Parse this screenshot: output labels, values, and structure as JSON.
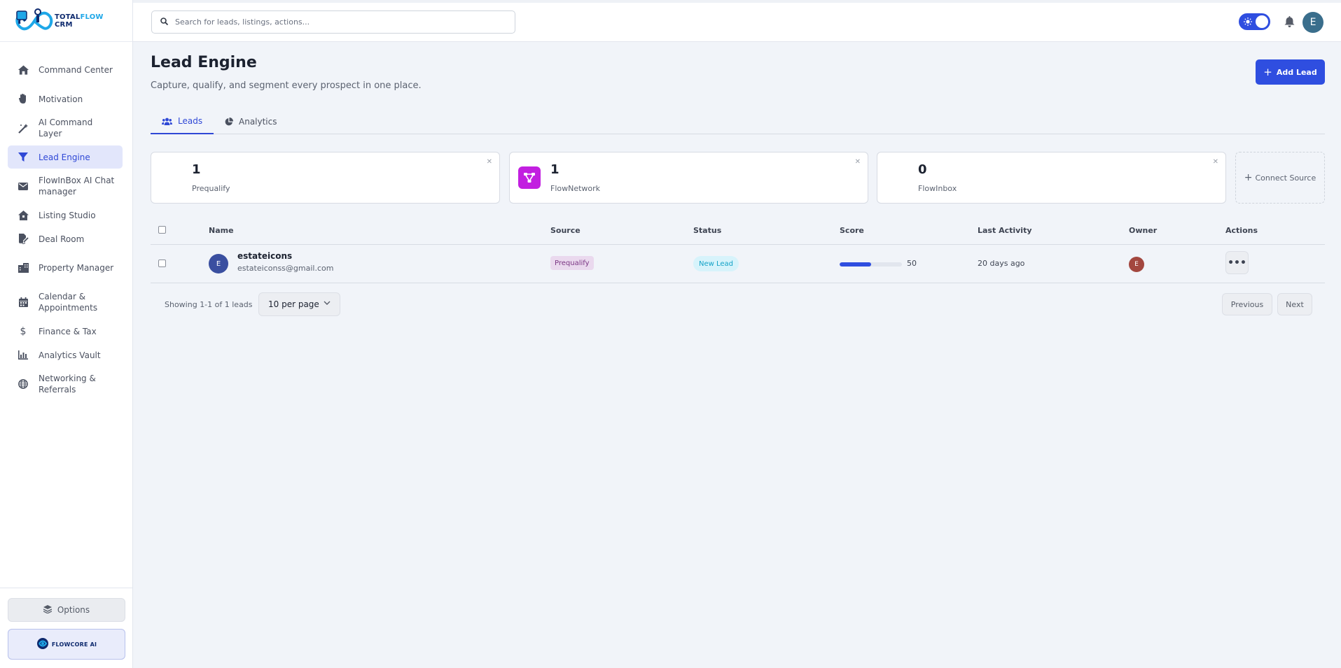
{
  "brand": {
    "line1": "TOTALFLOW",
    "line1_a": "TOTAL",
    "line1_b": "FLOW",
    "line2": "CRM"
  },
  "search": {
    "placeholder": "Search for leads, listings, actions..."
  },
  "user": {
    "initial": "E"
  },
  "sidebar": {
    "items": [
      {
        "label": "Command Center",
        "icon": "home-icon"
      },
      {
        "label": "Motivation",
        "icon": "hand-icon"
      },
      {
        "label": "AI Command Layer",
        "icon": "magic-wand-icon"
      },
      {
        "label": "Lead Engine",
        "icon": "filter-icon",
        "active": true
      },
      {
        "label": "FlowInBox AI Chat manager",
        "icon": "envelope-icon"
      },
      {
        "label": "Listing Studio",
        "icon": "house-icon"
      },
      {
        "label": "Deal Room",
        "icon": "file-signature-icon"
      },
      {
        "label": "Property Manager",
        "icon": "building-icon"
      },
      {
        "label": "Calendar & Appointments",
        "icon": "calendar-icon"
      },
      {
        "label": "Finance & Tax",
        "icon": "dollar-icon"
      },
      {
        "label": "Analytics Vault",
        "icon": "chart-icon"
      },
      {
        "label": "Networking & Referrals",
        "icon": "globe-icon"
      }
    ],
    "options_label": "Options",
    "flowcore_label": "FLOWCORE AI"
  },
  "page": {
    "title": "Lead Engine",
    "subtitle": "Capture, qualify, and segment every prospect in one place.",
    "add_button": "Add Lead"
  },
  "tabs": [
    {
      "label": "Leads",
      "active": true
    },
    {
      "label": "Analytics",
      "active": false
    }
  ],
  "sources": [
    {
      "count": "1",
      "label": "Prequalify"
    },
    {
      "count": "1",
      "label": "FlowNetwork"
    },
    {
      "count": "0",
      "label": "FlowInbox"
    }
  ],
  "connect_source": "Connect Source",
  "table": {
    "columns": [
      "Name",
      "Source",
      "Status",
      "Score",
      "Last Activity",
      "Owner",
      "Actions"
    ],
    "rows": [
      {
        "initial": "E",
        "name": "estateicons",
        "email": "estateiconss@gmail.com",
        "source": "Prequalify",
        "status": "New Lead",
        "score": 50,
        "last_activity": "20 days ago",
        "owner_initial": "E",
        "actions": "•••"
      }
    ]
  },
  "pagination": {
    "showing": "Showing 1-1 of 1 leads",
    "per_page": "10 per page",
    "previous": "Previous",
    "next": "Next"
  },
  "colors": {
    "accent": "#2f4ee0",
    "active_nav_bg": "#e2e6fb",
    "source_badge_bg": "#ead9ee",
    "status_badge_bg": "#d7f3fb",
    "flownetwork_icon": "#c21fe0"
  }
}
